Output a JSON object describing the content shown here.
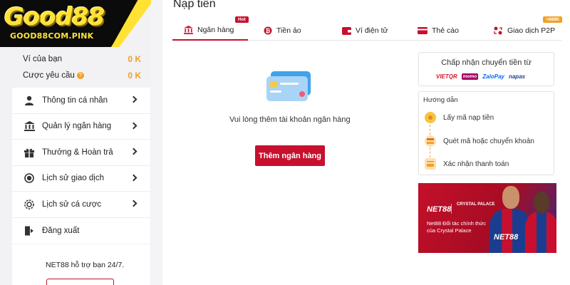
{
  "logo": {
    "text": "Good88",
    "subtext": "GOOD88COM.PINK"
  },
  "balance": {
    "wallet_label": "Ví của bạn",
    "wallet_value": "0 K",
    "bet_label": "Cược yêu cầu",
    "bet_value": "0 K"
  },
  "menu": {
    "items": [
      {
        "label": "Thông tin cá nhân",
        "icon": "user-icon"
      },
      {
        "label": "Quản lý ngân hàng",
        "icon": "bank-icon"
      },
      {
        "label": "Thưởng & Hoàn trả",
        "icon": "gift-icon"
      },
      {
        "label": "Lịch sử giao dịch",
        "icon": "history-icon"
      },
      {
        "label": "Lịch sử cá cược",
        "icon": "chip-icon"
      },
      {
        "label": "Đăng xuất",
        "icon": "logout-icon"
      }
    ],
    "support_text": "NET88 hỗ trợ bạn 24/7."
  },
  "page": {
    "title": "Nạp tiền"
  },
  "tabs": [
    {
      "label": "Ngân hàng",
      "active": true,
      "badge": "Hot"
    },
    {
      "label": "Tiền ảo",
      "active": false
    },
    {
      "label": "Ví điện tử",
      "active": false
    },
    {
      "label": "Thẻ cào",
      "active": false
    },
    {
      "label": "Giao dịch P2P",
      "active": false,
      "badge": "+888K"
    }
  ],
  "empty_state": {
    "message": "Vui lòng thêm tài khoản ngân hàng",
    "button_label": "Thêm ngân hàng"
  },
  "accept": {
    "title": "Chấp nhận chuyển tiền từ",
    "logos": [
      "VIETQR",
      "momo",
      "ZaloPay",
      "napas"
    ]
  },
  "guide": {
    "title": "Hướng dẫn",
    "steps": [
      "Lấy mã nạp tiền",
      "Quét mã hoặc chuyển khoản",
      "Xác nhận thanh toán"
    ]
  },
  "banner": {
    "brand": "NET88",
    "club": "CRYSTAL PALACE",
    "text": "Net88 Đối tác chính thức của Crystal Palace",
    "shirt_text": "NET88"
  },
  "colors": {
    "primary": "#c8102e",
    "accent": "#f2a023",
    "logo_yellow": "#ffe233"
  }
}
